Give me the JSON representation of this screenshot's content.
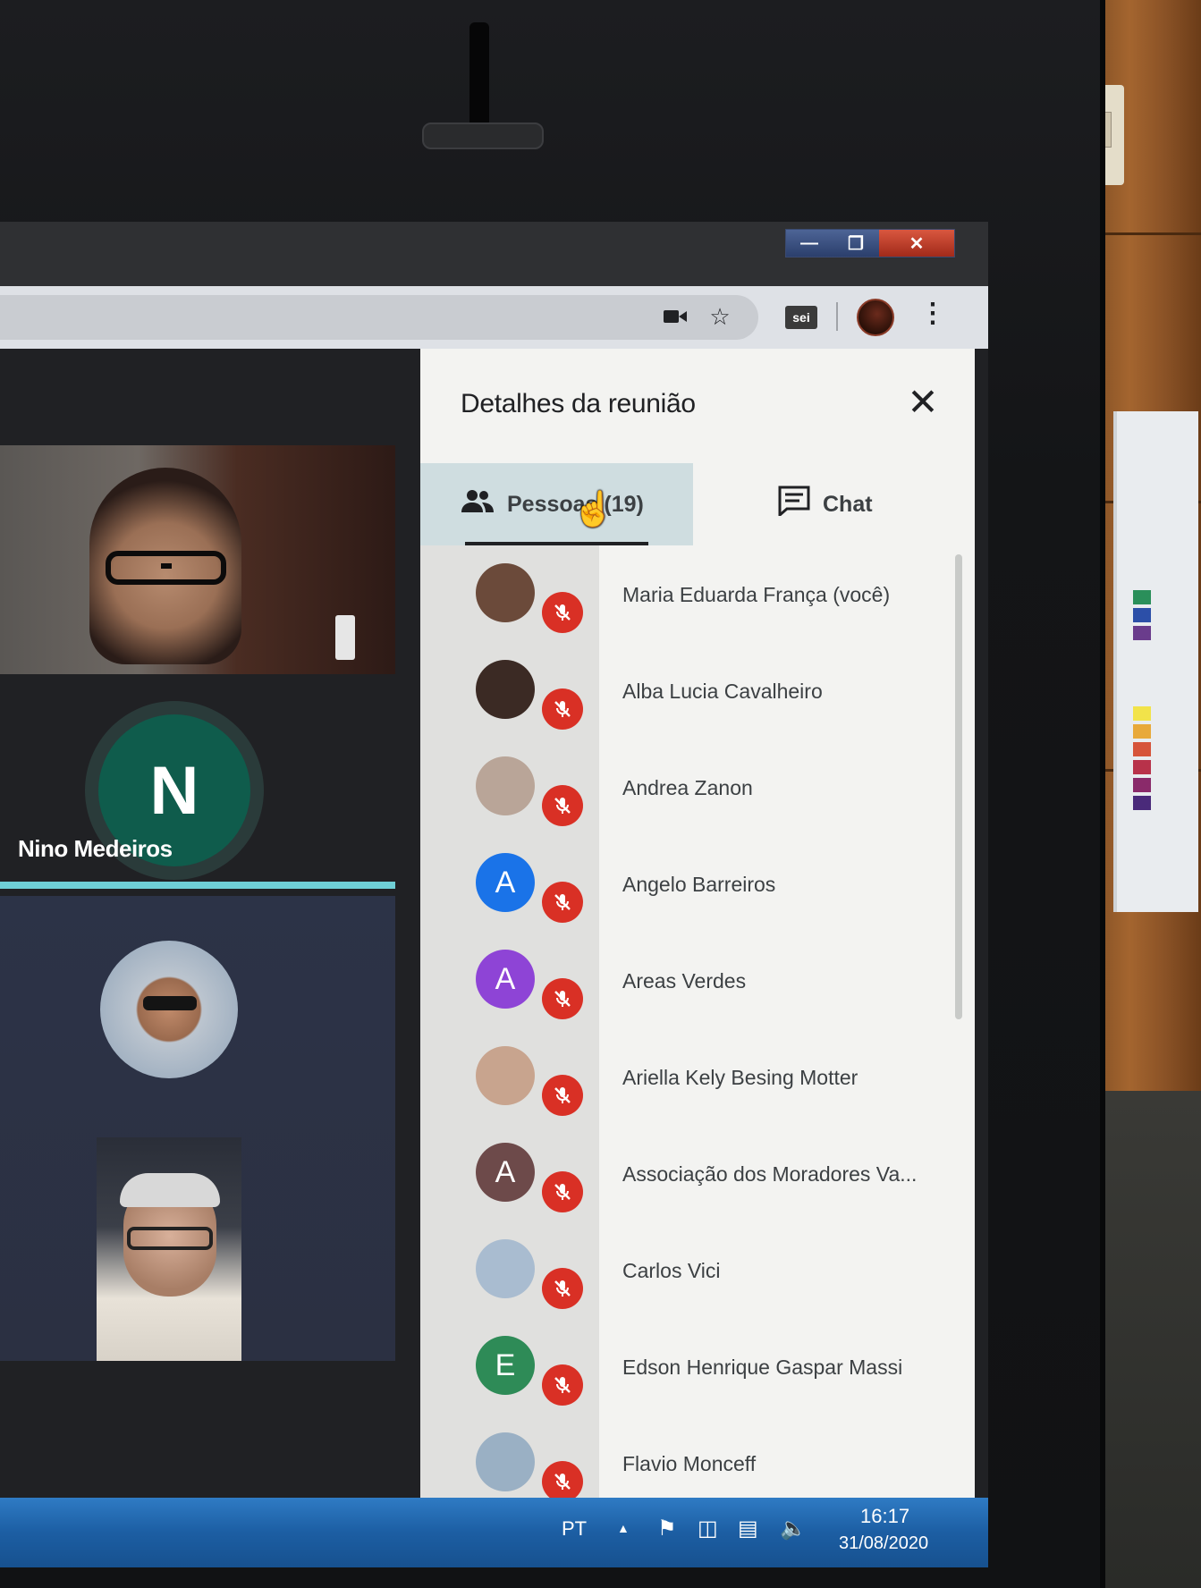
{
  "window": {
    "minimize_icon": "minimize-icon",
    "restore_icon": "restore-icon",
    "close_icon": "close-icon"
  },
  "browser": {
    "extension_label": "sei",
    "camera_icon": "camera-icon",
    "star_icon": "star-icon"
  },
  "grid": {
    "tile_n": {
      "initial": "N",
      "name": "Nino Medeiros"
    }
  },
  "panel": {
    "title": "Detalhes da reunião",
    "tabs": [
      {
        "label": "Pessoas (19)",
        "icon": "people-icon",
        "selected": true
      },
      {
        "label": "Chat",
        "icon": "chat-icon",
        "selected": false
      }
    ],
    "participants": [
      {
        "name": "Maria Eduarda França (você)",
        "initial": "",
        "color": "#6b4a3a",
        "muted": true
      },
      {
        "name": "Alba Lucia Cavalheiro",
        "initial": "",
        "color": "#3b2a24",
        "muted": true
      },
      {
        "name": "Andrea Zanon",
        "initial": "",
        "color": "#b9a598",
        "muted": true
      },
      {
        "name": "Angelo Barreiros",
        "initial": "A",
        "color": "#1a73e8",
        "muted": true
      },
      {
        "name": "Areas Verdes",
        "initial": "A",
        "color": "#8e44d6",
        "muted": true
      },
      {
        "name": "Ariella Kely Besing Motter",
        "initial": "",
        "color": "#c8a48e",
        "muted": true
      },
      {
        "name": "Associação dos Moradores Va...",
        "initial": "A",
        "color": "#6d4a4a",
        "muted": true
      },
      {
        "name": "Carlos Vici",
        "initial": "",
        "color": "#a9bcd0",
        "muted": true
      },
      {
        "name": "Edson Henrique Gaspar Massi",
        "initial": "E",
        "color": "#2e8b57",
        "muted": true
      },
      {
        "name": "Flavio Monceff",
        "initial": "",
        "color": "#9ab0c4",
        "muted": true
      }
    ]
  },
  "taskbar": {
    "language": "PT",
    "time": "16:17",
    "date": "31/08/2020"
  },
  "colors": {
    "mute_red": "#d93025",
    "speaking_bar": "#6fcfd6",
    "taskbar_blue": "#1c5ea3"
  }
}
